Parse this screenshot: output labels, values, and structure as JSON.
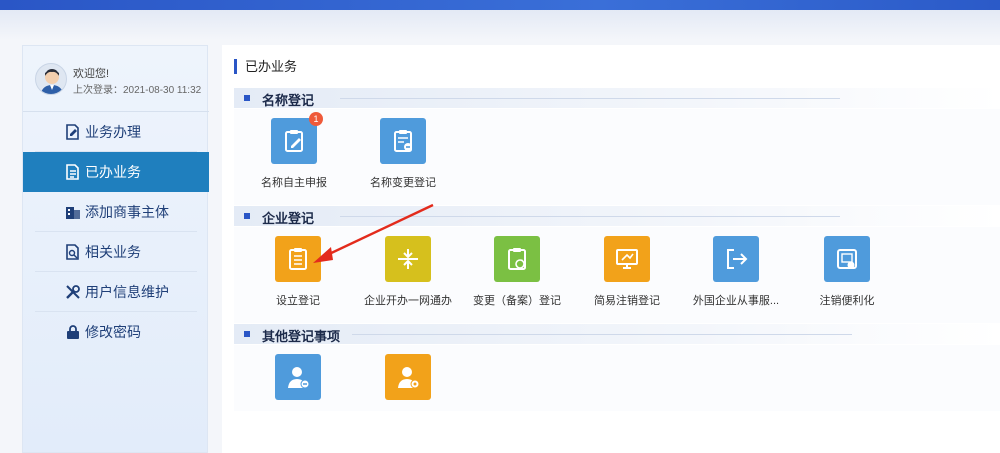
{
  "sidebar": {
    "welcome": "欢迎您!",
    "last_login": "上次登录：2021-08-30 11:32",
    "items": [
      {
        "label": "业务办理",
        "icon": "document-edit-icon",
        "active": false
      },
      {
        "label": "已办业务",
        "icon": "document-list-icon",
        "active": true
      },
      {
        "label": "添加商事主体",
        "icon": "building-icon",
        "active": false
      },
      {
        "label": "相关业务",
        "icon": "document-search-icon",
        "active": false
      },
      {
        "label": "用户信息维护",
        "icon": "wrench-icon",
        "active": false
      },
      {
        "label": "修改密码",
        "icon": "lock-icon",
        "active": false
      }
    ]
  },
  "main": {
    "title": "已办业务",
    "sections": [
      {
        "title": "名称登记",
        "tiles": [
          {
            "label": "名称自主申报",
            "icon": "clipboard-pen-icon",
            "color": "#4f9bdc",
            "badge": "1"
          },
          {
            "label": "名称变更登记",
            "icon": "clipboard-minus-icon",
            "color": "#4f9bdc"
          }
        ]
      },
      {
        "title": "企业登记",
        "tiles": [
          {
            "label": "设立登记",
            "icon": "clipboard-icon",
            "color": "#f2a21a"
          },
          {
            "label": "企业开办一网通办",
            "icon": "merge-icon",
            "color": "#d6c01d"
          },
          {
            "label": "变更（备案）登记",
            "icon": "clipboard-refresh-icon",
            "color": "#7bc043"
          },
          {
            "label": "简易注销登记",
            "icon": "monitor-arrow-icon",
            "color": "#f2a21a"
          },
          {
            "label": "外国企业从事服...",
            "icon": "exit-icon",
            "color": "#4f9bdc"
          },
          {
            "label": "注销便利化",
            "icon": "cancel-certificate-icon",
            "color": "#4f9bdc"
          }
        ]
      },
      {
        "title": "其他登记事项",
        "tiles": [
          {
            "label": "",
            "icon": "person-minus-icon",
            "color": "#4f9bdc"
          },
          {
            "label": "",
            "icon": "person-gear-icon",
            "color": "#f2a21a"
          }
        ]
      }
    ]
  }
}
